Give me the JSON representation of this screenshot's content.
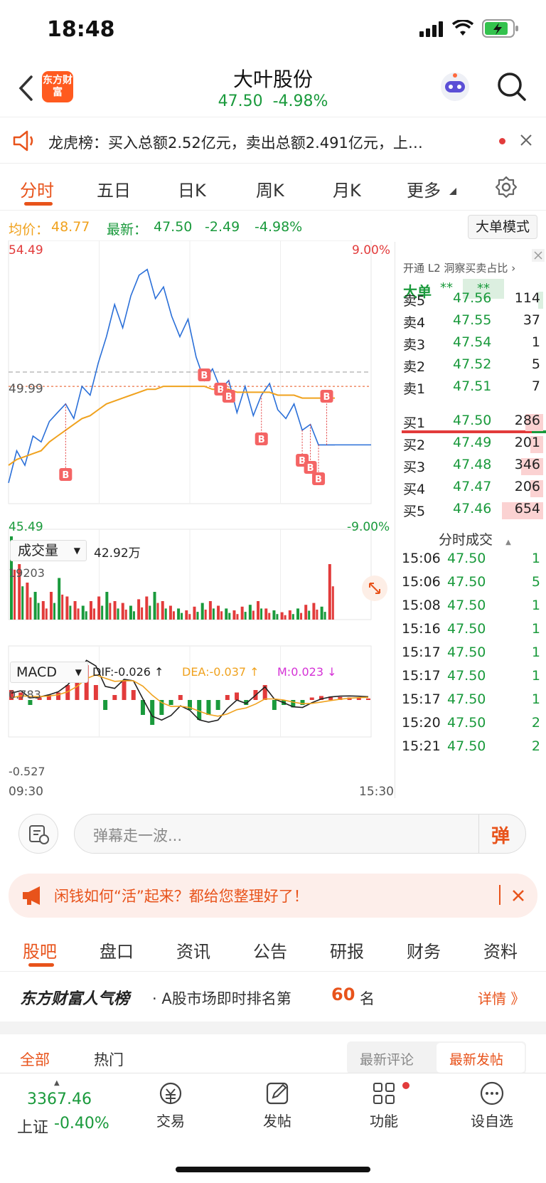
{
  "status_bar": {
    "time": "18:48"
  },
  "header": {
    "logo_text": "东方财富",
    "stock_name": "大叶股份",
    "price": "47.50",
    "change_pct": "-4.98%"
  },
  "notice": {
    "text": "龙虎榜：买入总额2.52亿元，卖出总额2.491亿元，上…"
  },
  "chart_tabs": [
    "分时",
    "五日",
    "日K",
    "周K",
    "月K",
    "更多"
  ],
  "info": {
    "avg_label": "均价：",
    "avg_value": "48.77",
    "latest_label": "最新：",
    "latest_value": "47.50",
    "change": "-2.49",
    "change_pct": "-4.98%",
    "mode_button": "大单模式"
  },
  "chart_data": [
    {
      "type": "line",
      "title": "",
      "series": [
        {
          "name": "",
          "values": [
            46.2,
            47.3,
            46.8,
            47.8,
            47.6,
            48.3,
            48.6,
            48.9,
            48.4,
            49.5,
            49.2,
            50.3,
            51.2,
            52.3,
            51.5,
            52.6,
            53.3,
            53.5,
            52.5,
            52.9,
            51.9,
            51.2,
            51.8,
            50.5,
            49.7,
            50.1,
            49.4,
            49.7,
            48.6,
            49.5,
            48.5,
            49.2,
            49.6,
            48.7,
            48.4,
            48.9,
            48.0,
            48.2,
            47.5,
            47.5,
            47.5
          ]
        },
        {
          "name": "均价",
          "values": [
            46.8,
            47.0,
            47.1,
            47.2,
            47.3,
            47.6,
            47.8,
            48.0,
            48.2,
            48.4,
            48.5,
            48.7,
            48.9,
            49.0,
            49.1,
            49.2,
            49.3,
            49.4,
            49.4,
            49.5,
            49.5,
            49.5,
            49.5,
            49.5,
            49.5,
            49.4,
            49.4,
            49.4,
            49.3,
            49.3,
            49.3,
            49.3,
            49.3,
            49.2,
            49.2,
            49.2,
            49.1,
            49.1,
            49.1,
            49.1,
            49.1
          ]
        }
      ],
      "ylim": [
        45.49,
        54.49
      ],
      "y_tick_labels": [
        "54.49",
        "49.99",
        "45.49"
      ],
      "pct_labels": [
        "9.00%",
        "-9.00%"
      ],
      "x_tick_labels": [
        "09:30",
        "15:30"
      ]
    },
    {
      "type": "bar",
      "title": "成交量",
      "total": "42.92万",
      "ymax_label": "19203",
      "values": [
        90,
        60,
        40,
        30,
        20,
        30,
        45,
        25,
        20,
        15,
        20,
        25,
        30,
        20,
        18,
        15,
        22,
        25,
        30,
        20,
        15,
        12,
        10,
        14,
        18,
        20,
        15,
        12,
        10,
        14,
        16,
        20,
        12,
        10,
        8,
        10,
        12,
        16,
        18,
        14,
        60
      ]
    },
    {
      "type": "bar",
      "title": "MACD",
      "dif": "DIF:-0.026 ↑",
      "dea": "DEA:-0.037 ↑",
      "m": "M:0.023 ↓",
      "y_tick_labels": [
        "0.783",
        "-0.527"
      ],
      "values": [
        0.2,
        0.15,
        -0.1,
        0.05,
        0.1,
        0.15,
        0.3,
        0.5,
        0.7,
        0.3,
        -0.2,
        0.1,
        0.4,
        0.2,
        -0.3,
        -0.5,
        -0.3,
        -0.1,
        0.1,
        -0.2,
        -0.4,
        -0.3,
        -0.2,
        0.1,
        0.15,
        -0.1,
        0.2,
        0.3,
        -0.2,
        -0.1,
        -0.15,
        -0.1,
        0.05,
        0.08,
        0.07,
        0.06,
        0.05,
        0.04,
        0.03
      ]
    }
  ],
  "order_book": {
    "header": "开通 L2 洞察买卖占比",
    "big_label": "大单",
    "big_val1": "**",
    "big_val2": "**",
    "sell": [
      {
        "label": "卖5",
        "price": "47.56",
        "vol": "114"
      },
      {
        "label": "卖4",
        "price": "47.55",
        "vol": "37"
      },
      {
        "label": "卖3",
        "price": "47.54",
        "vol": "1"
      },
      {
        "label": "卖2",
        "price": "47.52",
        "vol": "5"
      },
      {
        "label": "卖1",
        "price": "47.51",
        "vol": "7"
      }
    ],
    "buy": [
      {
        "label": "买1",
        "price": "47.50",
        "vol": "286"
      },
      {
        "label": "买2",
        "price": "47.49",
        "vol": "201"
      },
      {
        "label": "买3",
        "price": "47.48",
        "vol": "346"
      },
      {
        "label": "买4",
        "price": "47.47",
        "vol": "206"
      },
      {
        "label": "买5",
        "price": "47.46",
        "vol": "654"
      }
    ],
    "trades_title": "分时成交",
    "trades": [
      {
        "time": "15:06",
        "price": "47.50",
        "vol": "1"
      },
      {
        "time": "15:06",
        "price": "47.50",
        "vol": "5"
      },
      {
        "time": "15:08",
        "price": "47.50",
        "vol": "1"
      },
      {
        "time": "15:16",
        "price": "47.50",
        "vol": "1"
      },
      {
        "time": "15:17",
        "price": "47.50",
        "vol": "1"
      },
      {
        "time": "15:17",
        "price": "47.50",
        "vol": "1"
      },
      {
        "time": "15:17",
        "price": "47.50",
        "vol": "1"
      },
      {
        "time": "15:20",
        "price": "47.50",
        "vol": "2"
      },
      {
        "time": "15:21",
        "price": "47.50",
        "vol": "2"
      }
    ]
  },
  "danmu": {
    "placeholder": "弹幕走一波...",
    "send_label": "弹"
  },
  "promo": {
    "text": "闲钱如何“活”起来？都给您整理好了！"
  },
  "news_tabs": [
    "股吧",
    "盘口",
    "资讯",
    "公告",
    "研报",
    "财务",
    "资料"
  ],
  "rank": {
    "brand": "东方财富人气榜",
    "text": "· A股市场即时排名第",
    "num": "60",
    "unit": "名",
    "detail": "详情 》"
  },
  "filters": {
    "all": "全部",
    "hot": "热门",
    "latest_comment": "最新评论",
    "latest_post": "最新发帖"
  },
  "bottom_nav": {
    "index_value": "3367.46",
    "index_name": "上证",
    "index_change": "-0.40%",
    "items": [
      "交易",
      "发帖",
      "功能",
      "设自选"
    ]
  },
  "colors": {
    "up": "#e23b3b",
    "down": "#1a9a3c",
    "accent": "#e8531b",
    "avg": "#f0a21e",
    "price_line": "#2a6fd8"
  }
}
